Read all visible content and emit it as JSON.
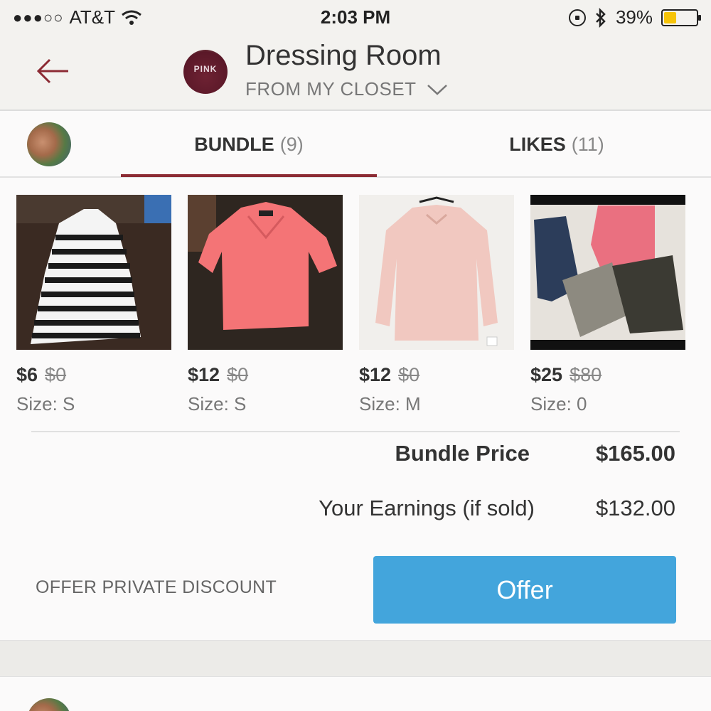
{
  "status_bar": {
    "signal": "●●●○○",
    "carrier": "AT&T",
    "time": "2:03 PM",
    "battery": "39%",
    "battery_level": 0.39,
    "battery_color": "#f6c409"
  },
  "header": {
    "title": "Dressing Room",
    "subtitle": "FROM MY CLOSET",
    "avatar_text": "PINK",
    "back_icon": "back-arrow-icon",
    "accent_color": "#8c2b34"
  },
  "tabs": [
    {
      "label": "BUNDLE",
      "count": "(9)",
      "active": true
    },
    {
      "label": "LIKES",
      "count": "(11)",
      "active": false
    }
  ],
  "items": [
    {
      "price": "$6",
      "original": "$0",
      "size": "Size: S"
    },
    {
      "price": "$12",
      "original": "$0",
      "size": "Size: S"
    },
    {
      "price": "$12",
      "original": "$0",
      "size": "Size: M"
    },
    {
      "price": "$25",
      "original": "$80",
      "size": "Size: 0"
    }
  ],
  "summary": {
    "bundle_price_label": "Bundle Price",
    "bundle_price_value": "$165.00",
    "earnings_label": "Your Earnings (if sold)",
    "earnings_value": "$132.00"
  },
  "actions": {
    "discount_label": "OFFER PRIVATE DISCOUNT",
    "offer_label": "Offer",
    "offer_color": "#43a5dc"
  }
}
